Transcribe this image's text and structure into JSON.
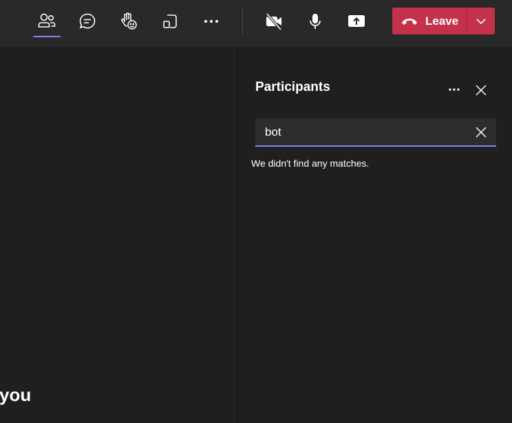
{
  "toolbar": {
    "buttons": [
      {
        "name": "people",
        "icon": "people-icon",
        "active": true
      },
      {
        "name": "chat",
        "icon": "chat-icon",
        "active": false
      },
      {
        "name": "reactions",
        "icon": "raise-hand-reaction-icon",
        "active": false
      },
      {
        "name": "view",
        "icon": "view-layout-icon",
        "active": false
      },
      {
        "name": "more",
        "icon": "more-icon",
        "active": false
      },
      {
        "name": "camera",
        "icon": "camera-off-icon",
        "active": false
      },
      {
        "name": "mic",
        "icon": "microphone-icon",
        "active": false
      },
      {
        "name": "share",
        "icon": "share-screen-icon",
        "active": false
      }
    ],
    "leave": {
      "label": "Leave",
      "icon": "phone-hangup-icon",
      "menu_icon": "chevron-down-icon"
    }
  },
  "stage": {
    "partial_text": "you"
  },
  "participants_panel": {
    "title": "Participants",
    "search": {
      "value": "bot",
      "placeholder": ""
    },
    "no_results_message": "We didn't find any matches."
  },
  "colors": {
    "accent": "#7f85f5",
    "leave_button": "#c4314b",
    "background": "#1f1f1f",
    "toolbar": "#292929"
  }
}
